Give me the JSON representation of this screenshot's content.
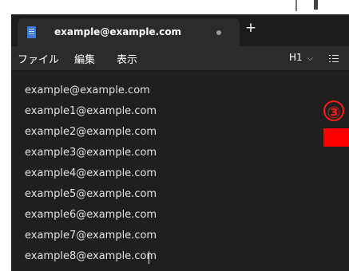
{
  "window": {
    "tab_title": "example@example.com",
    "tab_status": "unsaved-dot",
    "new_tab_label": "+",
    "doc_icon": "notepad-icon"
  },
  "menu": {
    "items": [
      "ファイル",
      "編集",
      "表示"
    ],
    "heading_value": "H1",
    "heading_chevron": "⌵",
    "list_icon": "bullet-list-icon"
  },
  "document": {
    "lines": [
      "example@example.com",
      "example1@example.com",
      "example2@example.com",
      "example3@example.com",
      "example4@example.com",
      "example5@example.com",
      "example6@example.com",
      "example7@example.com",
      "example8@example.com"
    ]
  },
  "annotations": {
    "step_label": "③",
    "accent_color": "#ff0000"
  }
}
